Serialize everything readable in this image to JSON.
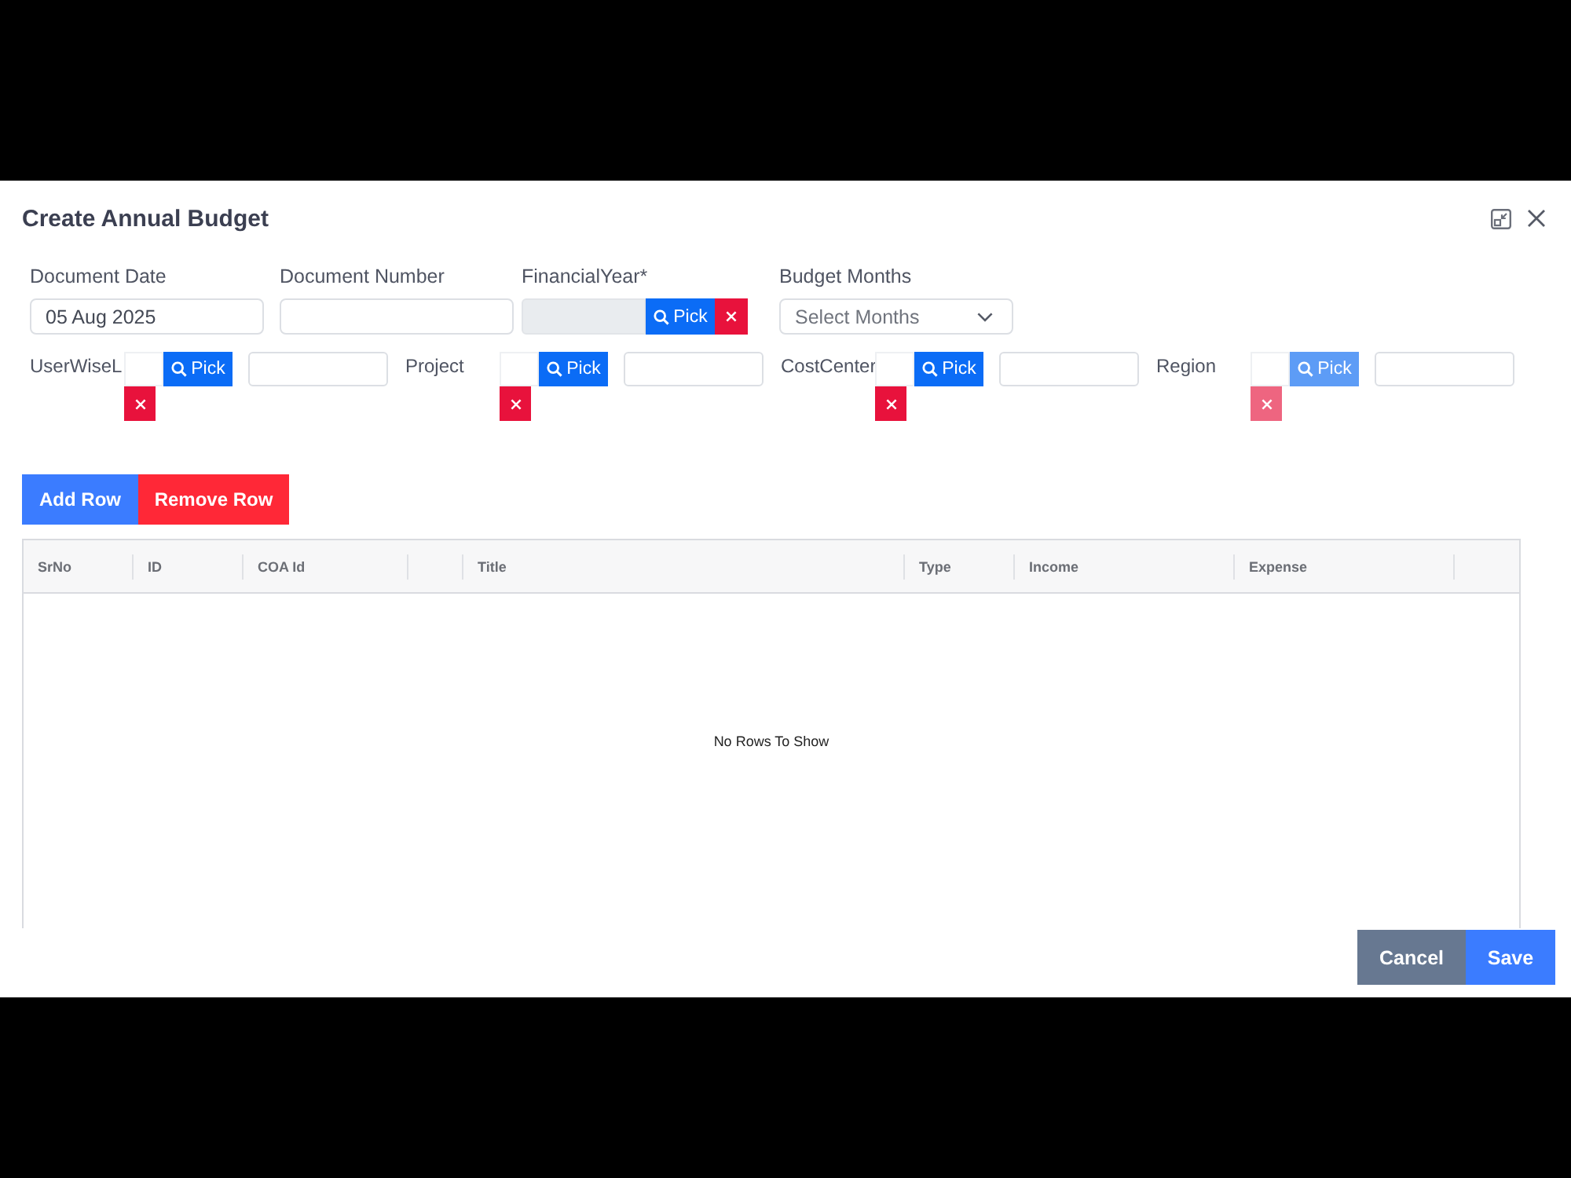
{
  "dialog": {
    "title": "Create Annual Budget"
  },
  "fields_row": [
    {
      "kind": "date",
      "label": "Document Date",
      "value": "05 Aug 2025"
    },
    {
      "kind": "text",
      "label": "Document Number"
    },
    {
      "kind": "picker",
      "label": "FinancialYear*",
      "pick_label": "Pick",
      "input_disabled": true,
      "buttons_disabled": false
    },
    {
      "kind": "select",
      "label": "Budget Months",
      "placeholder": "Select Months"
    }
  ],
  "lookups": [
    {
      "label": "UserWiseL",
      "pick_label": "Pick",
      "buttons_disabled": false
    },
    {
      "label": "Project",
      "pick_label": "Pick",
      "buttons_disabled": false
    },
    {
      "label": "CostCenter",
      "pick_label": "Pick",
      "buttons_disabled": false
    },
    {
      "label": "Region",
      "pick_label": "Pick",
      "buttons_disabled": true
    }
  ],
  "table_actions": [
    {
      "kind": "add",
      "label": "Add Row"
    },
    {
      "kind": "remove",
      "label": "Remove Row"
    }
  ],
  "table": {
    "columns": [
      {
        "label": "SrNo"
      },
      {
        "label": "ID"
      },
      {
        "label": "COA Id"
      },
      {},
      {
        "label": "Title"
      },
      {
        "label": "Type"
      },
      {
        "label": "Income"
      },
      {
        "label": "Expense"
      }
    ],
    "empty_message": "No Rows To Show"
  },
  "footer_buttons": [
    {
      "kind": "secondary",
      "label": "Cancel"
    },
    {
      "kind": "primary",
      "label": "Save"
    }
  ]
}
